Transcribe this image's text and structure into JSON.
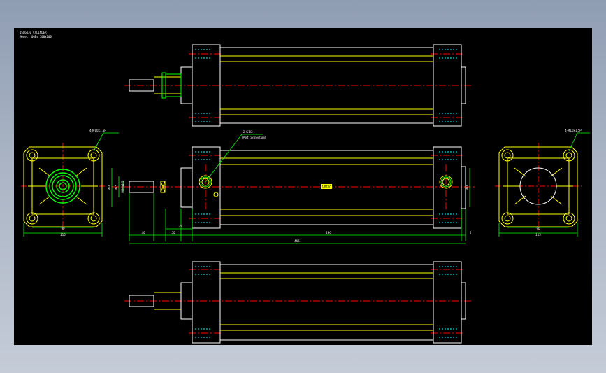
{
  "drawing": {
    "title_line1": "ISO6430 CYLINDER",
    "title_line2": "Model: QGBs 100x200",
    "center_tag": "AIRTAC",
    "callouts": {
      "port_thread": "2-G1/2",
      "port_note": "(Port connection)",
      "left_holes": "4-M10x1.5P",
      "right_holes": "4-M10x1.5P"
    },
    "dims": {
      "left_width_inner": "90",
      "left_width_outer": "115",
      "right_width_inner": "90",
      "right_width_outer": "115",
      "rod_len": "40",
      "nose_len": "50",
      "flange": "25",
      "body_len": "286",
      "tail": "6",
      "total_len": "465",
      "rod_dia": "Ø25",
      "thread": "M20x1.5",
      "boss_dia": "Ø56",
      "port_dia": "Ø16"
    }
  },
  "colors": {
    "background": "#000000",
    "outline": "#ffffff",
    "hidden": "#ffff00",
    "center": "#ff0000",
    "dimension": "#00ff00",
    "thread": "#00ffff"
  }
}
